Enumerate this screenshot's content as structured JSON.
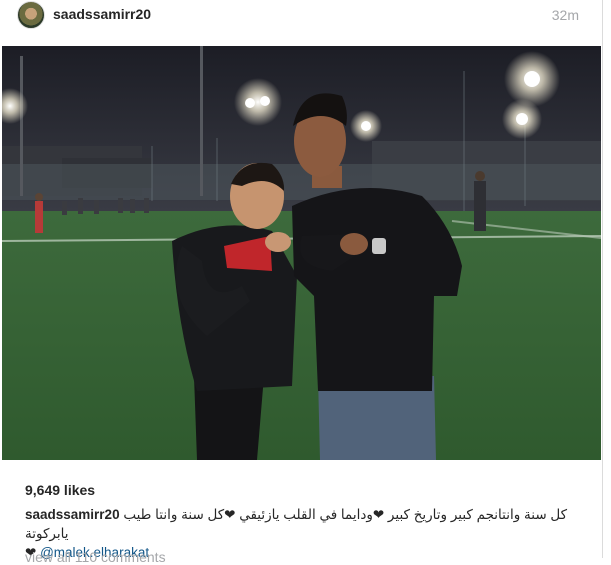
{
  "post": {
    "username": "saadssamirr20",
    "time_ago": "32m",
    "likes": "9,649 likes",
    "caption": {
      "username": "saadssamirr20",
      "text": "كل سنة وانتانجم كبير وتاريخ كبير ❤ودايما في القلب يازئيقي ❤كل سنة وانتا طيب يابركوتة",
      "heart": "❤",
      "mention": "@malek.elharakat"
    },
    "view_all_comments": "view all 110 comments"
  },
  "colors": {
    "text": "#262626",
    "muted": "#a5a7aa",
    "link": "#125688",
    "divider": "#dbdbdb"
  },
  "icons": {
    "avatar": "profile-photo"
  }
}
